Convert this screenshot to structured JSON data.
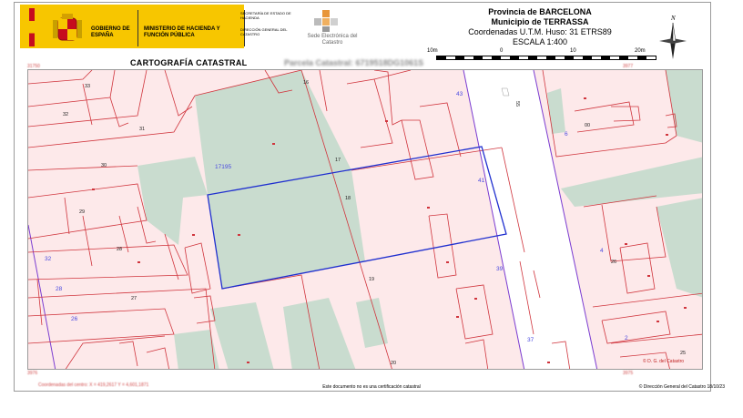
{
  "header": {
    "gobierno": "GOBIERNO DE ESPAÑA",
    "ministerio": "MINISTERIO DE HACIENDA Y FUNCIÓN PÚBLICA",
    "secretaria": "SECRETARÍA DE ESTADO DE HACIENDA",
    "direccion": "DIRECCIÓN GENERAL DEL CATASTRO",
    "sede": "Sede Electrónica del Catastro",
    "provincia": "Provincia de BARCELONA",
    "municipio": "Municipio de TERRASSA",
    "coordenadas": "Coordenadas U.T.M. Huso: 31 ETRS89",
    "escala": "ESCALA 1:400",
    "scale_ticks": [
      "10m",
      "0",
      "10",
      "20m"
    ],
    "north": "N"
  },
  "titles": {
    "cartografia": "CARTOGRAFÍA CATASTRAL",
    "parcela": "Parcela Catastral: 6719518DG1061S"
  },
  "map": {
    "parcel_numbers": [
      "33",
      "32",
      "31",
      "30",
      "29",
      "28",
      "27",
      "26",
      "16",
      "17",
      "18",
      "19",
      "20",
      "43",
      "41",
      "39",
      "37",
      "00",
      "4",
      "26",
      "25",
      "28",
      "32",
      "17195",
      "6",
      "55",
      "2"
    ],
    "corner_codes_left": [
      "31750",
      "3977",
      "3976",
      "3975"
    ],
    "colors": {
      "parcel_fill": "#fde9ea",
      "green_fill": "#c9dccf",
      "line": "#d0353d",
      "selected": "#1f2fcf",
      "street_line": "#7a3bd1"
    }
  },
  "footer": {
    "coords_left": "Coordenadas del centro: X = 419,2617 Y = 4,601,1871",
    "notice": "Este documento no es una certificación catastral",
    "copyright": "© Dirección General del Catastro 18/10/23",
    "dgc": "© D. G. del Catastro"
  }
}
